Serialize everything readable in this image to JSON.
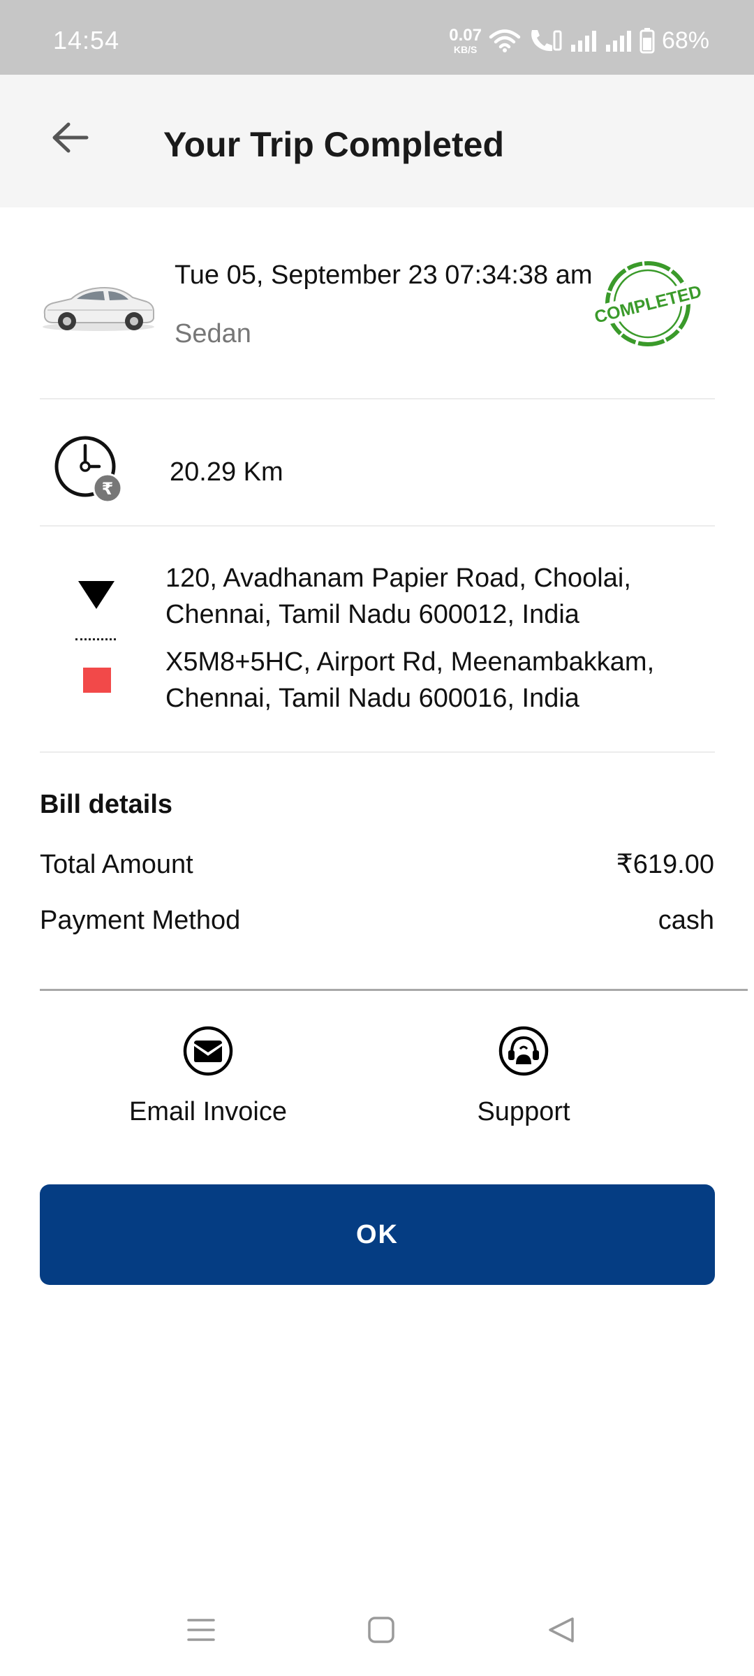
{
  "status_bar": {
    "time": "14:54",
    "net_speed_value": "0.07",
    "net_speed_unit": "KB/S",
    "battery_percent": "68%",
    "icons": [
      "wifi-icon",
      "wifi-calling-icon",
      "signal-icon",
      "signal-icon",
      "battery-icon"
    ]
  },
  "header": {
    "title": "Your Trip Completed",
    "back_icon": "arrow-left-icon"
  },
  "trip": {
    "datetime": "Tue 05, September 23 07:34:38 am",
    "vehicle_type": "Sedan",
    "status_stamp": "COMPLETED",
    "stamp_color": "#3a9a2a",
    "distance": "20.29 Km",
    "pickup_address": "120, Avadhanam Papier Road, Choolai, Chennai, Tamil Nadu 600012, India",
    "drop_address": "X5M8+5HC, Airport Rd, Meenambakkam, Chennai, Tamil Nadu 600016, India",
    "drop_marker_color": "#f24949"
  },
  "bill": {
    "title": "Bill details",
    "rows": [
      {
        "label": "Total Amount",
        "value": "₹619.00"
      },
      {
        "label": "Payment Method",
        "value": "cash"
      }
    ]
  },
  "actions": {
    "email_invoice": "Email Invoice",
    "support": "Support"
  },
  "ok_button": {
    "label": "OK",
    "color": "#053d83"
  },
  "nav_bar": {
    "icons": [
      "menu-icon",
      "home-square-icon",
      "back-triangle-icon"
    ]
  }
}
